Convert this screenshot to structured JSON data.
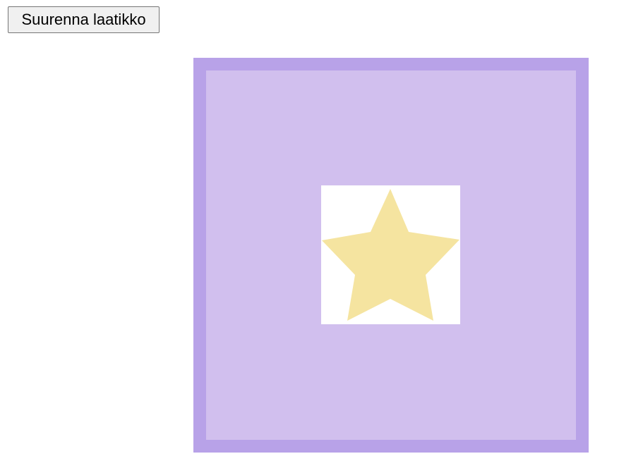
{
  "toolbar": {
    "enlarge_label": "Suurenna laatikko"
  },
  "box": {
    "frame_color": "#b8a2e8",
    "fill_color": "#d1bfee",
    "tile_color": "#ffffff"
  },
  "star": {
    "icon": "star-icon",
    "color": "#f5e4a0"
  }
}
